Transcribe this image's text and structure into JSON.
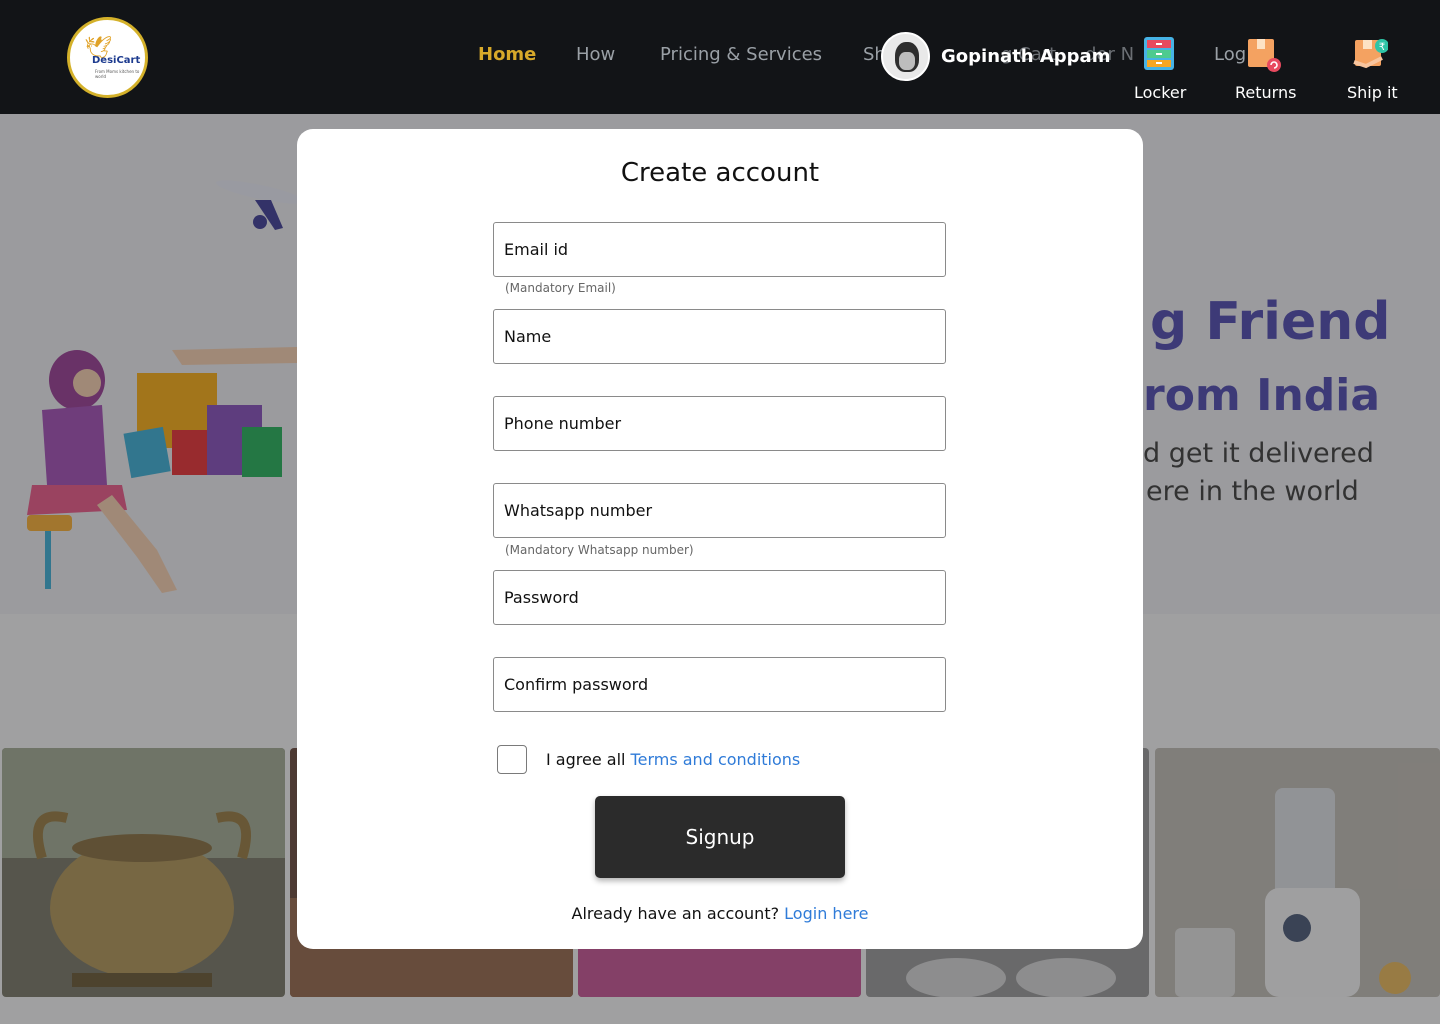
{
  "header": {
    "logo": {
      "name": "DesiCart",
      "tagline": "From Moms kitchen to world"
    },
    "nav": [
      "Home",
      "How",
      "Pricing & Services",
      "Sh",
      "Log"
    ],
    "nav_fragments": [
      "g Cart",
      "der N"
    ],
    "user_name": "Gopinath Appam",
    "actions": [
      "Locker",
      "Returns",
      "Ship it"
    ],
    "accent": "#d7a92a"
  },
  "hero": {
    "line1": "g Friend",
    "line2": "rom India",
    "line3": "d get it delivered",
    "line4": "ere in the world",
    "accent": "#3f3aa8"
  },
  "modal": {
    "title": "Create account",
    "fields": [
      {
        "label": "Email id",
        "hint": "(Mandatory Email)"
      },
      {
        "label": "Name"
      },
      {
        "label": "Phone number"
      },
      {
        "label": "Whatsapp number",
        "hint": "(Mandatory Whatsapp number)"
      },
      {
        "label": "Password"
      },
      {
        "label": "Confirm password"
      }
    ],
    "agree_text": "I agree all ",
    "terms_link": "Terms and conditions",
    "signup_label": "Signup",
    "already_text": "Already have an account? ",
    "login_link": "Login here",
    "link_color": "#2f7bd8"
  }
}
